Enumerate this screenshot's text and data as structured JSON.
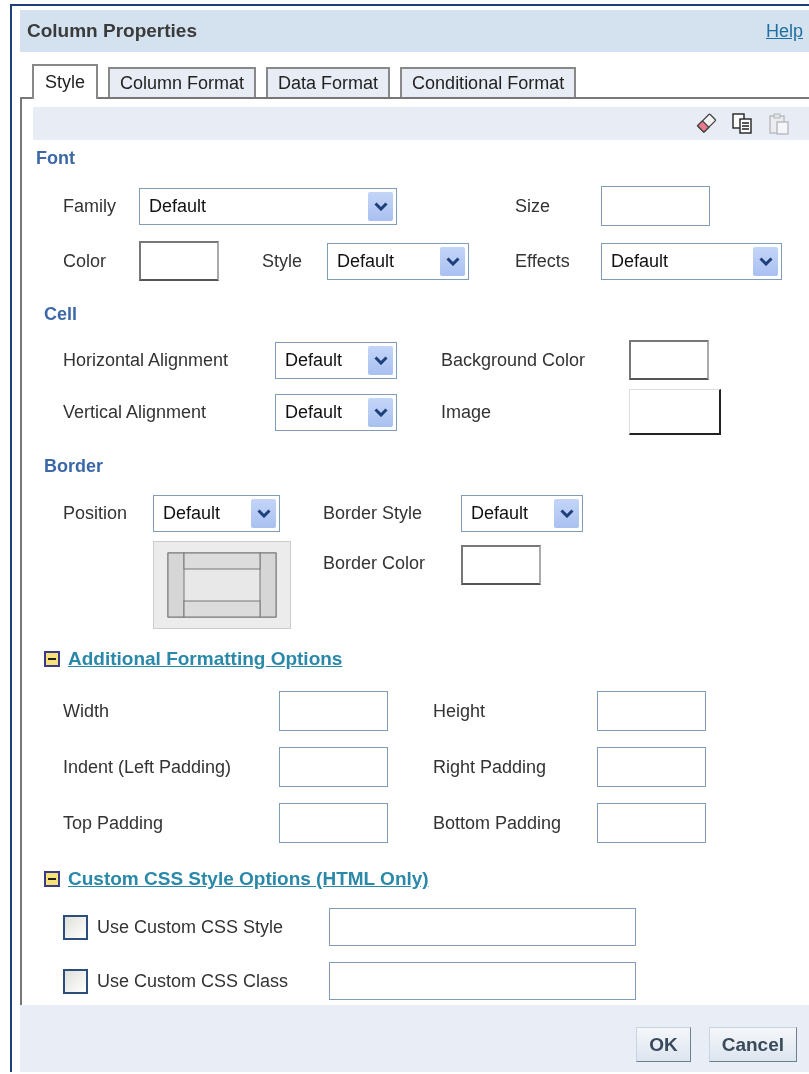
{
  "dialog": {
    "title": "Column Properties",
    "help": "Help"
  },
  "tabs": [
    {
      "label": "Style",
      "selected": true
    },
    {
      "label": "Column Format",
      "selected": false
    },
    {
      "label": "Data Format",
      "selected": false
    },
    {
      "label": "Conditional Format",
      "selected": false
    }
  ],
  "toolbar": [
    {
      "kind": "eraser",
      "disabled": false
    },
    {
      "kind": "copy",
      "disabled": false
    },
    {
      "kind": "paste",
      "disabled": true
    }
  ],
  "sections": [
    {
      "heading": "Font",
      "rows": [
        [
          {
            "kind": "label",
            "text": "Family"
          },
          {
            "kind": "select",
            "value": "Default"
          },
          {
            "kind": "gap"
          },
          {
            "kind": "gap"
          },
          {
            "kind": "label",
            "text": "Size"
          },
          {
            "kind": "input"
          }
        ],
        [
          {
            "kind": "label",
            "text": "Color"
          },
          {
            "kind": "swatch"
          },
          {
            "kind": "label",
            "text": "Style"
          },
          {
            "kind": "select",
            "value": "Default"
          },
          {
            "kind": "label",
            "text": "Effects"
          },
          {
            "kind": "select",
            "value": "Default"
          }
        ]
      ]
    },
    {
      "heading": "Cell",
      "rows": [
        [
          {
            "kind": "label",
            "text": "Horizontal Alignment"
          },
          {
            "kind": "select",
            "value": "Default"
          },
          {
            "kind": "label",
            "text": "Background Color"
          },
          {
            "kind": "swatch"
          }
        ],
        [
          {
            "kind": "label",
            "text": "Vertical Alignment"
          },
          {
            "kind": "select",
            "value": "Default"
          },
          {
            "kind": "label",
            "text": "Image"
          },
          {
            "kind": "image"
          }
        ]
      ]
    },
    {
      "heading": "Border",
      "rows": [
        [
          {
            "kind": "label",
            "text": "Position"
          },
          {
            "kind": "select",
            "value": "Default"
          },
          {
            "kind": "label",
            "text": "Border Style"
          },
          {
            "kind": "select",
            "value": "Default"
          }
        ],
        [
          {
            "kind": "gap"
          },
          {
            "kind": "preview"
          },
          {
            "kind": "label",
            "text": "Border Color"
          },
          {
            "kind": "swatch"
          }
        ]
      ]
    },
    {
      "heading": "Additional Formatting Options",
      "expanded": true,
      "rows": [
        [
          {
            "kind": "label",
            "text": "Width"
          },
          {
            "kind": "input"
          },
          {
            "kind": "label",
            "text": "Height"
          },
          {
            "kind": "input"
          }
        ],
        [
          {
            "kind": "label",
            "text": "Indent (Left Padding)"
          },
          {
            "kind": "input"
          },
          {
            "kind": "label",
            "text": "Right Padding"
          },
          {
            "kind": "input"
          }
        ],
        [
          {
            "kind": "label",
            "text": "Top Padding"
          },
          {
            "kind": "input"
          },
          {
            "kind": "label",
            "text": "Bottom Padding"
          },
          {
            "kind": "input"
          }
        ]
      ]
    },
    {
      "heading": "Custom CSS Style Options (HTML Only)",
      "expanded": true,
      "rows": [
        [
          {
            "kind": "checkbox",
            "label": "Use Custom CSS Style",
            "checked": false
          },
          {
            "kind": "input"
          }
        ],
        [
          {
            "kind": "checkbox",
            "label": "Use Custom CSS Class",
            "checked": false
          },
          {
            "kind": "input"
          }
        ]
      ]
    }
  ],
  "buttons": [
    "OK",
    "Cancel"
  ]
}
